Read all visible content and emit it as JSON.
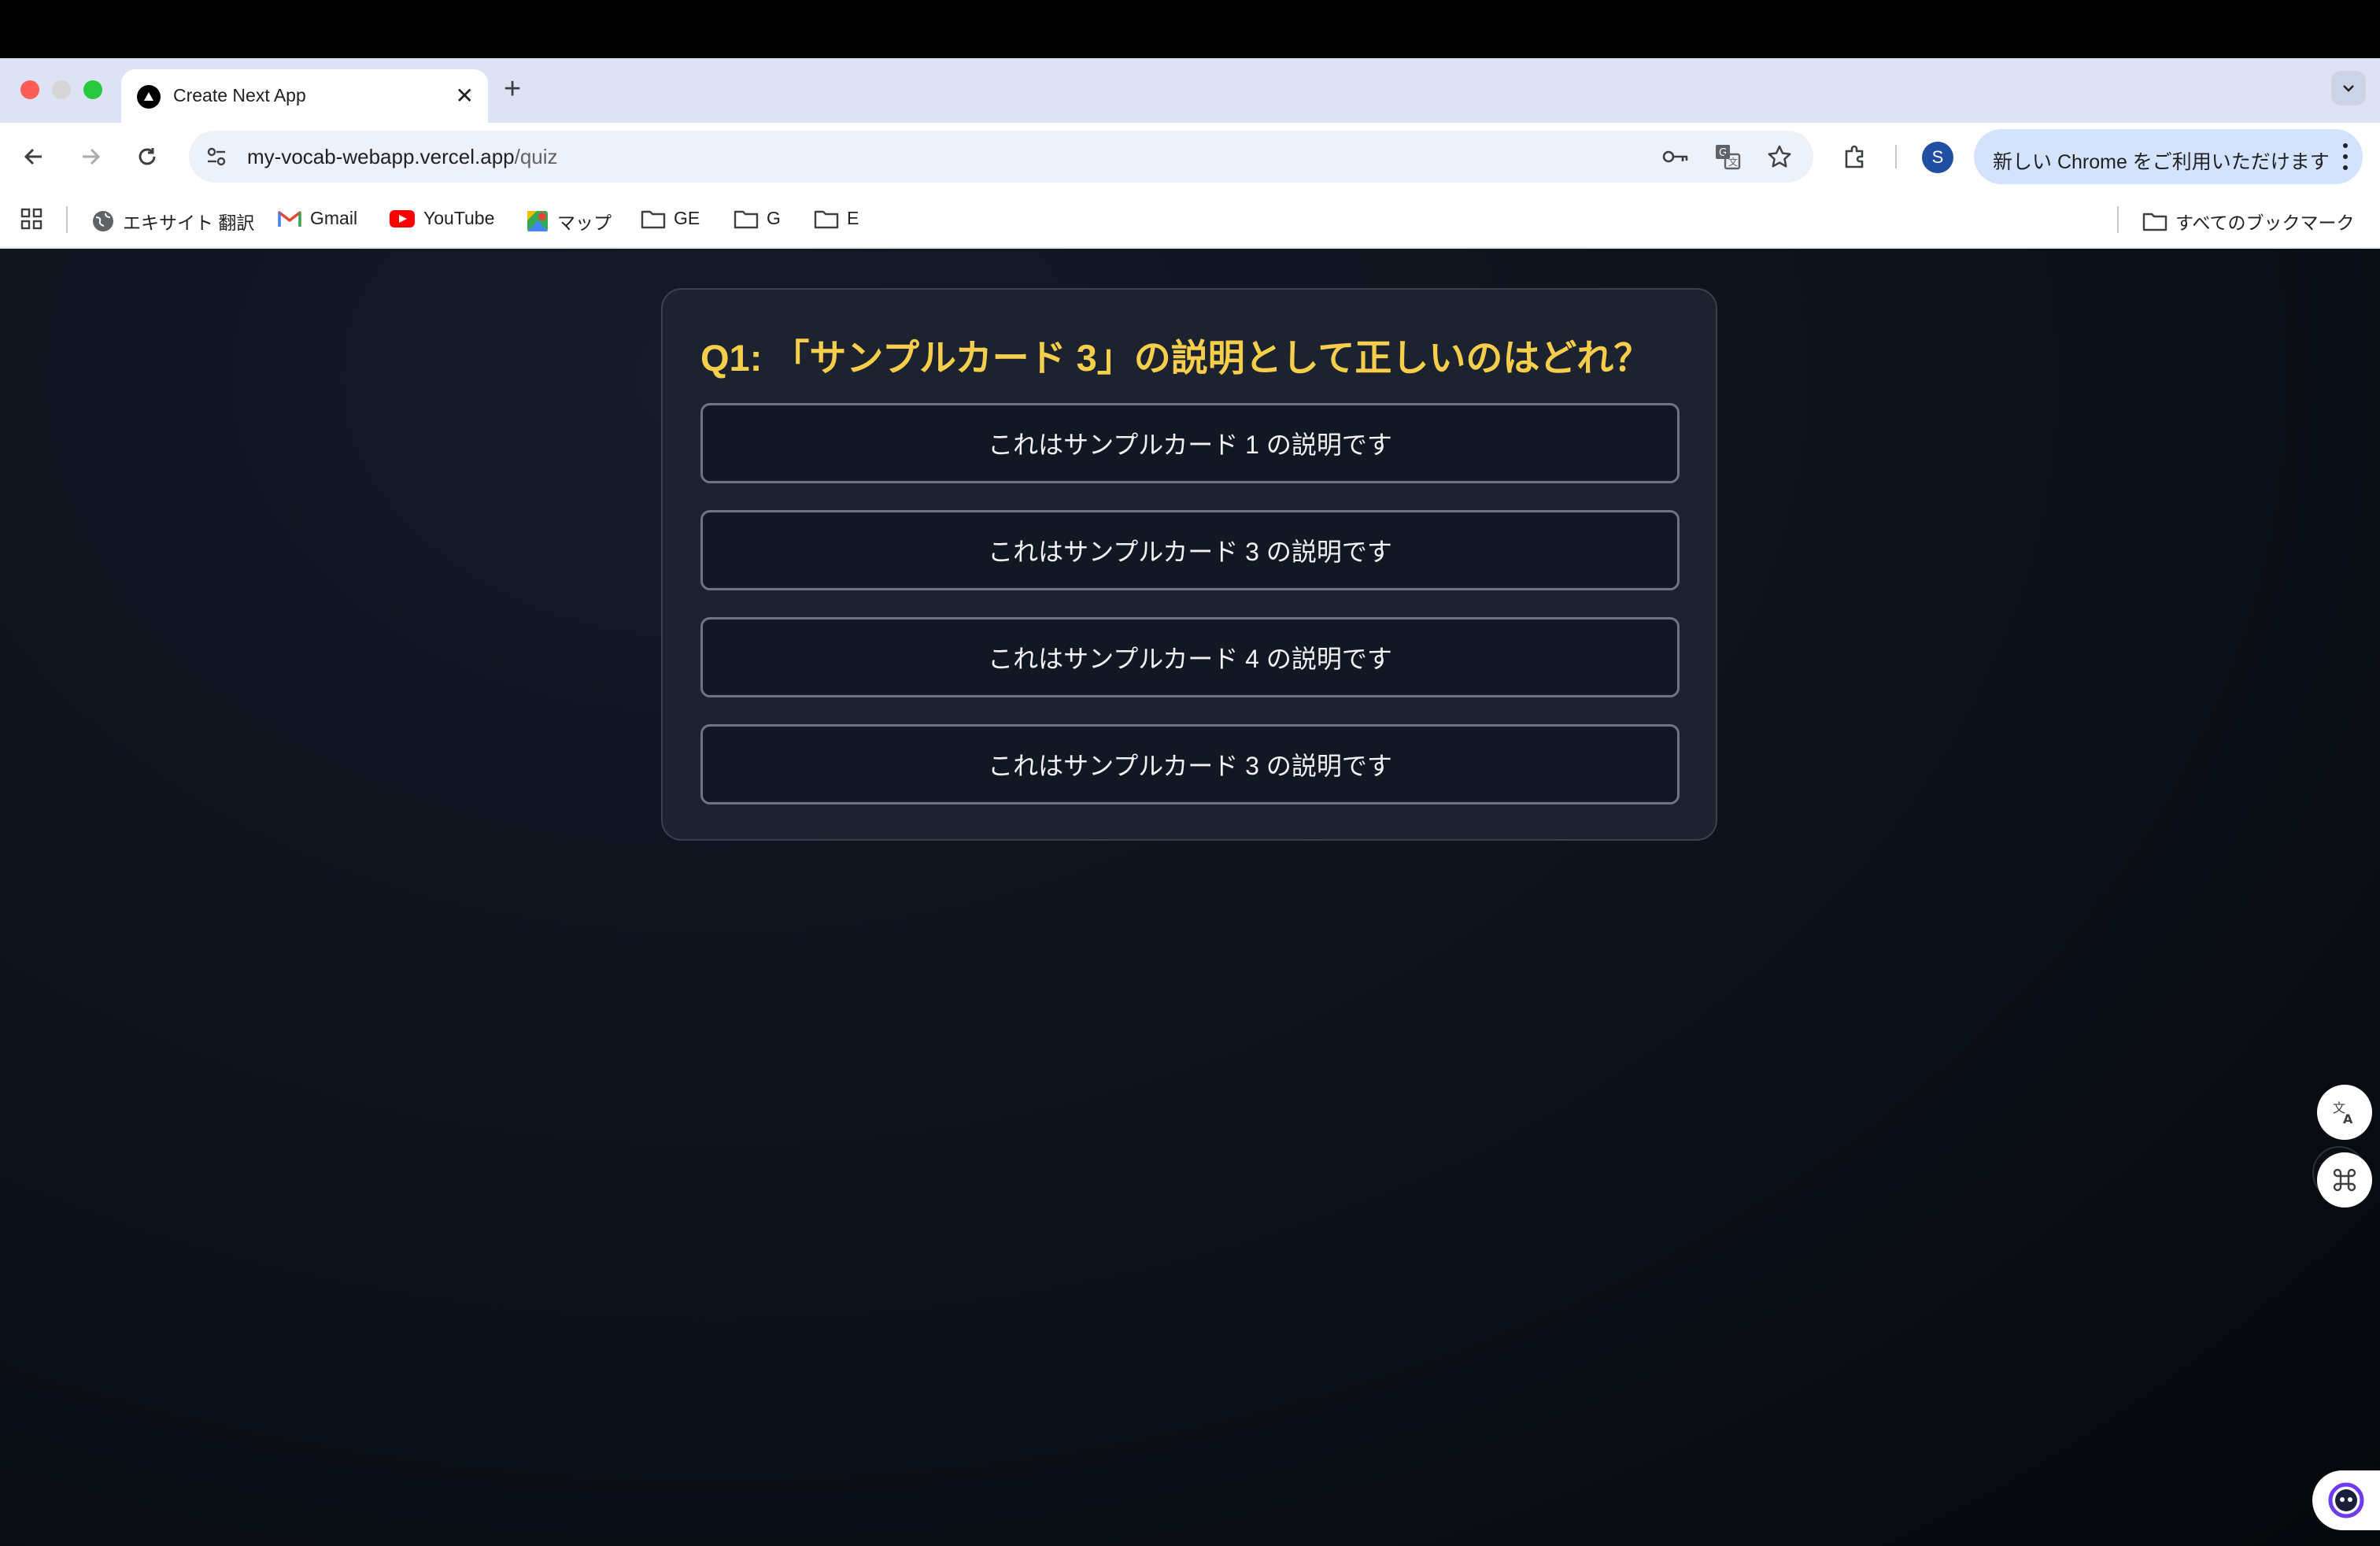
{
  "browser": {
    "tab_title": "Create Next App",
    "url_host": "my-vocab-webapp.vercel.app",
    "url_path": "/quiz",
    "profile_initial": "S",
    "promo_label": "新しい Chrome をご利用いただけます"
  },
  "bookmarks": [
    {
      "label": "エキサイト 翻訳",
      "icon": "globe-icon"
    },
    {
      "label": "Gmail",
      "icon": "gmail-icon"
    },
    {
      "label": "YouTube",
      "icon": "youtube-icon"
    },
    {
      "label": "マップ",
      "icon": "maps-icon"
    },
    {
      "label": "GE",
      "icon": "folder-icon"
    },
    {
      "label": "G",
      "icon": "folder-icon"
    },
    {
      "label": "E",
      "icon": "folder-icon"
    }
  ],
  "all_bookmarks_label": "すべてのブックマーク",
  "quiz": {
    "question": "Q1: 「サンプルカード 3」の説明として正しいのはどれ？",
    "options": [
      "これはサンプルカード 1 の説明です",
      "これはサンプルカード 3 の説明です",
      "これはサンプルカード 4 の説明です",
      "これはサンプルカード 3 の説明です"
    ]
  },
  "colors": {
    "question": "#f6ce4c",
    "card_bg": "#1c222e",
    "option_bg": "#121724",
    "option_border": "#6e7480"
  }
}
